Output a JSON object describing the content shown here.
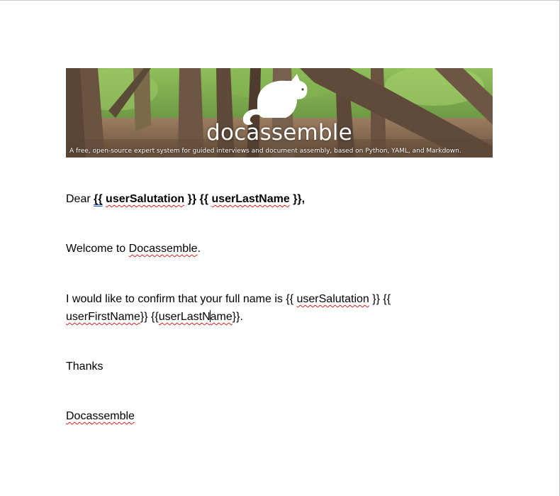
{
  "banner": {
    "title": "docassemble",
    "tagline": "A free, open-source expert system for guided interviews and document assembly, based on Python, YAML, and Markdown.",
    "logo_icon": "cat-icon",
    "colors": {
      "ground": "#8a6d52",
      "foliage": "#7fae4c",
      "trunk": "#6e5644",
      "logo": "#ffffff"
    }
  },
  "letter": {
    "greeting": {
      "dear": "Dear",
      "open_brace_1": "{{",
      "salutation_var": "userSalutation",
      "close_brace_1": "}}",
      "open_brace_2": "{{",
      "lastname_var": "userLastName",
      "close_brace_2": "}}",
      "comma": ","
    },
    "welcome": {
      "prefix": "Welcome to",
      "product": "Docassemble",
      "suffix": "."
    },
    "confirm": {
      "line1_prefix": "I would like to confirm that your full name is {{",
      "salutation_var": "userSalutation",
      "line1_suffix": "}} {{",
      "firstname_var": "userFirstName",
      "line2_mid": "}} {{",
      "lastname_part1": "userLastN",
      "lastname_part2": "ame",
      "line2_end": "}}."
    },
    "thanks": "Thanks",
    "signature": "Docassemble"
  },
  "colors": {
    "spelling_squiggle": "#e02020",
    "grammar_underline": "#2050c0",
    "page_border": "#c8c8c8"
  }
}
